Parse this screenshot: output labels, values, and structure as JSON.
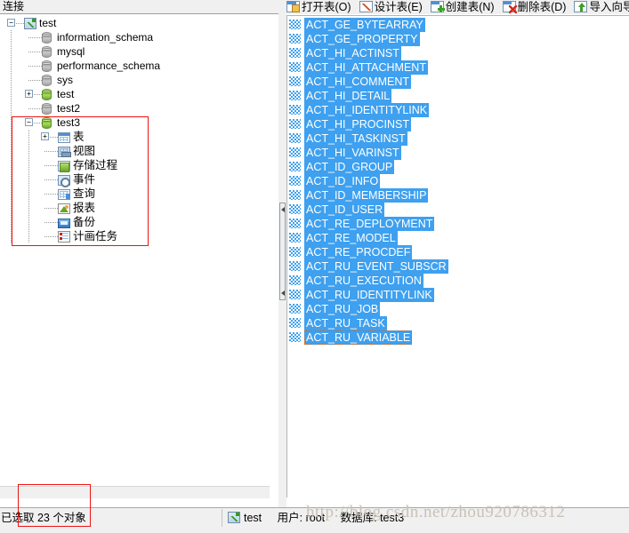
{
  "left_panel": {
    "header": "连接",
    "tree": [
      {
        "label": "test",
        "icon": "connection-icon",
        "depth": 0,
        "expander": "minus"
      },
      {
        "label": "information_schema",
        "icon": "database-icon",
        "depth": 1,
        "expander": "none"
      },
      {
        "label": "mysql",
        "icon": "database-icon",
        "depth": 1,
        "expander": "none"
      },
      {
        "label": "performance_schema",
        "icon": "database-icon",
        "depth": 1,
        "expander": "none"
      },
      {
        "label": "sys",
        "icon": "database-icon",
        "depth": 1,
        "expander": "none"
      },
      {
        "label": "test",
        "icon": "database-open-icon",
        "depth": 1,
        "expander": "plus"
      },
      {
        "label": "test2",
        "icon": "database-icon",
        "depth": 1,
        "expander": "none"
      },
      {
        "label": "test3",
        "icon": "database-open-icon",
        "depth": 1,
        "expander": "minus"
      },
      {
        "label": "表",
        "icon": "table-icon",
        "depth": 2,
        "expander": "plus"
      },
      {
        "label": "视图",
        "icon": "view-icon",
        "depth": 2,
        "expander": "none"
      },
      {
        "label": "存储过程",
        "icon": "procedure-icon",
        "depth": 2,
        "expander": "none"
      },
      {
        "label": "事件",
        "icon": "event-icon",
        "depth": 2,
        "expander": "none"
      },
      {
        "label": "查询",
        "icon": "query-icon",
        "depth": 2,
        "expander": "none"
      },
      {
        "label": "报表",
        "icon": "report-icon",
        "depth": 2,
        "expander": "none"
      },
      {
        "label": "备份",
        "icon": "backup-icon",
        "depth": 2,
        "expander": "none"
      },
      {
        "label": "计画任务",
        "icon": "scheduled-task-icon",
        "depth": 2,
        "expander": "none"
      }
    ]
  },
  "toolbar": {
    "items": [
      {
        "label": "打开表(O)",
        "icon": "open-table-icon",
        "cls": "ti-open"
      },
      {
        "label": "设计表(E)",
        "icon": "design-table-icon",
        "cls": "ti-design"
      },
      {
        "label": "创建表(N)",
        "icon": "new-table-icon",
        "cls": "ti-new"
      },
      {
        "label": "删除表(D)",
        "icon": "delete-table-icon",
        "cls": "ti-del"
      },
      {
        "label": "导入向导",
        "icon": "import-wizard-icon",
        "cls": "ti-imp"
      }
    ]
  },
  "object_list": {
    "selected_all": true,
    "focused_item": "ACT_RU_VARIABLE",
    "items": [
      "ACT_GE_BYTEARRAY",
      "ACT_GE_PROPERTY",
      "ACT_HI_ACTINST",
      "ACT_HI_ATTACHMENT",
      "ACT_HI_COMMENT",
      "ACT_HI_DETAIL",
      "ACT_HI_IDENTITYLINK",
      "ACT_HI_PROCINST",
      "ACT_HI_TASKINST",
      "ACT_HI_VARINST",
      "ACT_ID_GROUP",
      "ACT_ID_INFO",
      "ACT_ID_MEMBERSHIP",
      "ACT_ID_USER",
      "ACT_RE_DEPLOYMENT",
      "ACT_RE_MODEL",
      "ACT_RE_PROCDEF",
      "ACT_RU_EVENT_SUBSCR",
      "ACT_RU_EXECUTION",
      "ACT_RU_IDENTITYLINK",
      "ACT_RU_JOB",
      "ACT_RU_TASK",
      "ACT_RU_VARIABLE"
    ]
  },
  "status_bar": {
    "selection_text": "已选取 23 个对象",
    "connection": "test",
    "user_label": "用户: root",
    "database_label": "数据库: test3"
  },
  "watermark": "http://blog.csdn.net/zhou920786312",
  "colors": {
    "selection_blue": "#3ea0ef",
    "annotation_red": "#ee1111",
    "chrome_gray": "#f0f0f0"
  }
}
